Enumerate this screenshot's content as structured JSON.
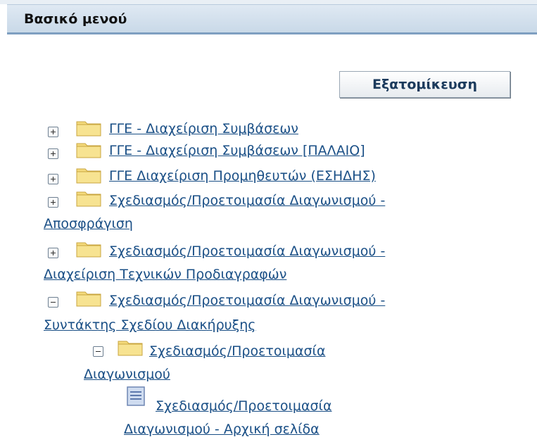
{
  "header": {
    "title": "Βασικό μενού"
  },
  "toolbar": {
    "personalize_label": "Εξατομίκευση"
  },
  "tree": {
    "items": [
      {
        "line1": "ΓΓΕ - Διαχείριση Συμβάσεων",
        "expander": "plus",
        "icon": "folder-icon"
      },
      {
        "line1": "ΓΓΕ - Διαχείριση Συμβάσεων [ΠΑΛΑΙΟ]",
        "expander": "plus",
        "icon": "folder-icon"
      },
      {
        "line1": "ΓΓΕ Διαχείριση Προμηθευτών (ΕΣΗΔΗΣ)",
        "expander": "plus",
        "icon": "folder-icon"
      },
      {
        "line1": "Σχεδιασμός/Προετοιμασία Διαγωνισμού -",
        "line2": "Αποσφράγιση",
        "expander": "plus",
        "icon": "folder-icon"
      },
      {
        "line1": "Σχεδιασμός/Προετοιμασία Διαγωνισμού -",
        "line2": "Διαχείριση Τεχνικών Προδιαγραφών",
        "expander": "plus",
        "icon": "folder-icon"
      },
      {
        "line1": "Σχεδιασμός/Προετοιμασία Διαγωνισμού -",
        "line2": "Συντάκτης Σχεδίου Διακήρυξης",
        "expander": "minus",
        "icon": "folder-icon"
      },
      {
        "line1": "Σχεδιασμός/Προετοιμασία",
        "line2": "Διαγωνισμού",
        "expander": "minus",
        "icon": "folder-icon"
      },
      {
        "line1": "Σχεδιασμός/Προετοιμασία",
        "line2": "Διαγωνισμού - Αρχική σελίδα",
        "icon": "page-icon"
      }
    ]
  },
  "colors": {
    "link": "#1a4f86",
    "header_bg": "#d3e0ee",
    "header_border": "#7f9fc1",
    "folder": "#f2d675"
  }
}
